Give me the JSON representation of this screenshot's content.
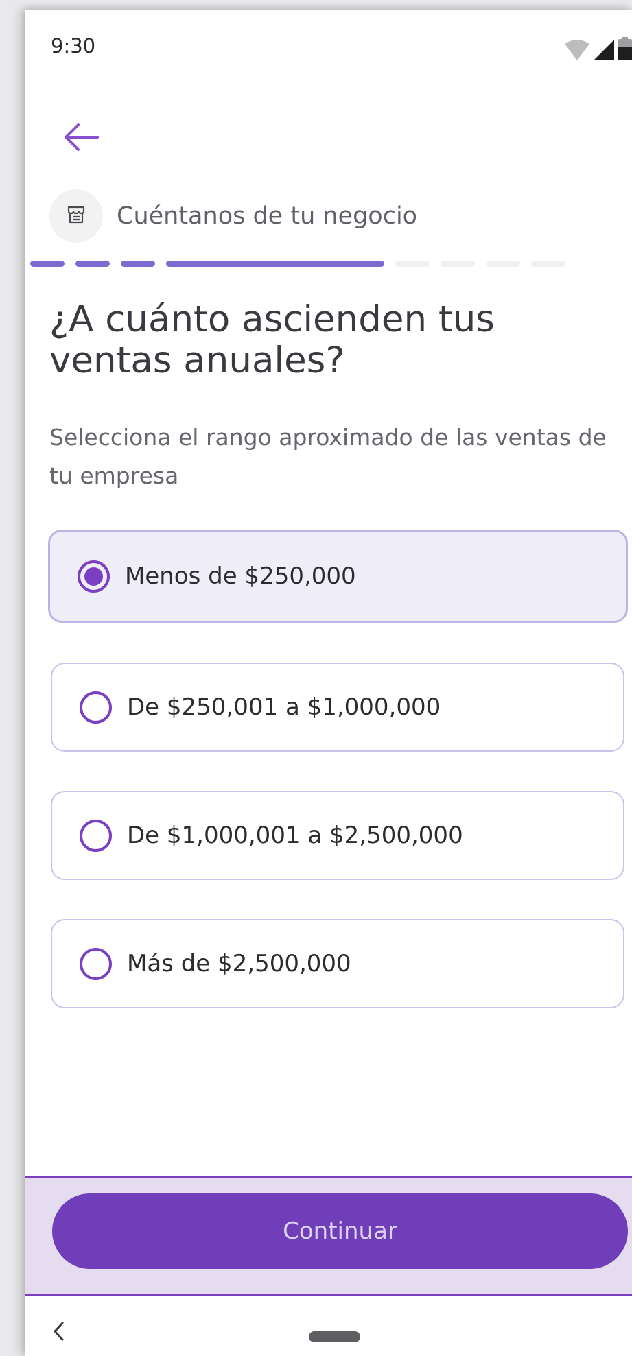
{
  "status_bar": {
    "time": "9:30",
    "icons": [
      "wifi-icon",
      "signal-icon",
      "battery-icon"
    ]
  },
  "header": {
    "back_icon": "arrow-left-icon",
    "step_icon": "store-icon",
    "step_title": "Cuéntanos de tu negocio"
  },
  "progress": {
    "total_steps": 8,
    "completed_steps": 4
  },
  "question": {
    "title": "¿A cuánto ascienden tus ventas anuales?",
    "subtitle": "Selecciona el rango aproximado de las ventas de tu empresa"
  },
  "options": [
    {
      "label": "Menos de $250,000",
      "selected": true
    },
    {
      "label": "De $250,001 a $1,000,000",
      "selected": false
    },
    {
      "label": "De $1,000,001 a $2,500,000",
      "selected": false
    },
    {
      "label": "Más de $2,500,000",
      "selected": false
    }
  ],
  "footer": {
    "continue_label": "Continuar"
  },
  "colors": {
    "accent": "#7c3fc1",
    "button": "#6f3eb8",
    "progress_active": "#7b6bd1",
    "progress_inactive": "#f0f0f2",
    "selected_option_bg": "#eeedf8"
  }
}
